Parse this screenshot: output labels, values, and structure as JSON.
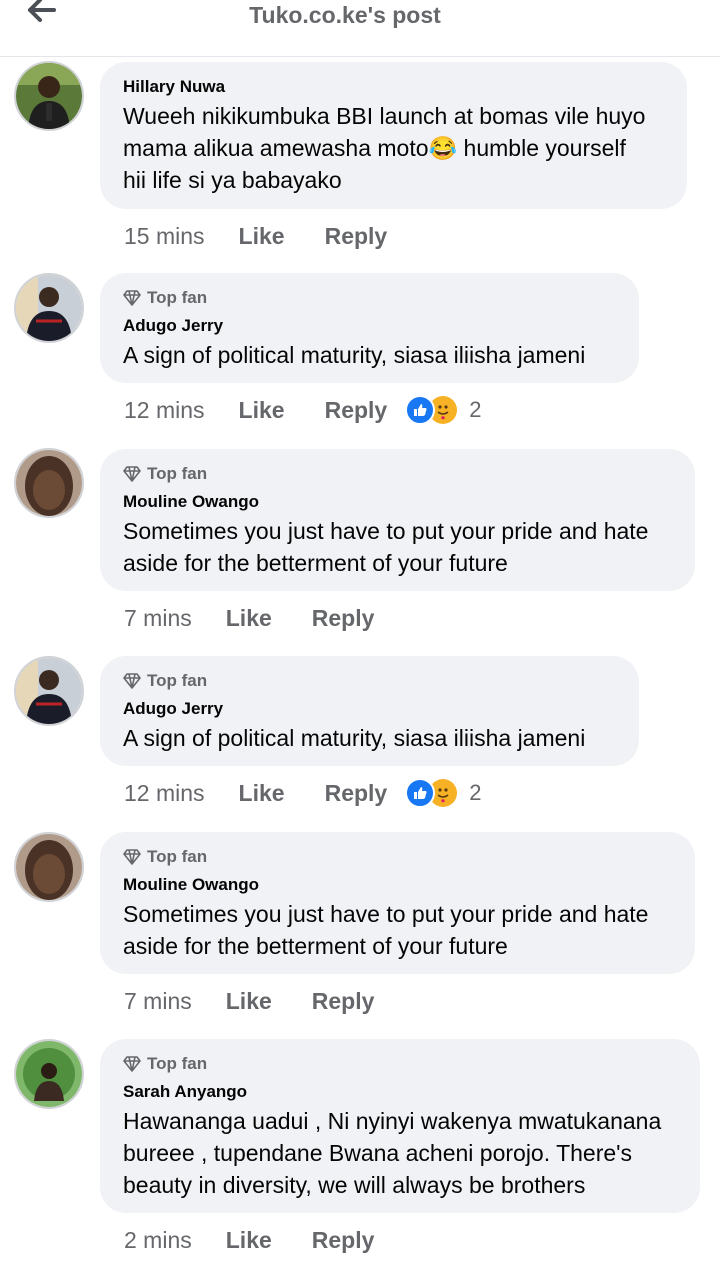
{
  "header": {
    "title": "Tuko.co.ke's post"
  },
  "colors": {
    "accent": "#1877f2",
    "bubble": "#f0f2f5",
    "meta_text": "#65676b"
  },
  "comments": [
    {
      "author": "Hillary Nuwa",
      "top_fan": false,
      "lines": [
        "Wueeh nikikumbuka BBI launch at bomas vile huyo",
        "mama alikua amewasha moto😂 humble yourself",
        "hii life si ya babayako"
      ],
      "time": "15 mins",
      "like": "Like",
      "reply": "Reply",
      "reactions": null
    },
    {
      "author": "Adugo Jerry",
      "top_fan": true,
      "badge": "Top fan",
      "lines": [
        "A sign of political maturity, siasa iliisha jameni"
      ],
      "time": "12 mins",
      "like": "Like",
      "reply": "Reply",
      "reactions": "2",
      "reaction_icons": [
        "like-icon",
        "care-icon"
      ]
    },
    {
      "author": "Mouline Owango",
      "top_fan": true,
      "badge": "Top fan",
      "lines": [
        "Sometimes you just have to put your pride and hate",
        "aside for the betterment of your future"
      ],
      "time": "7 mins",
      "like": "Like",
      "reply": "Reply",
      "reactions": null
    },
    {
      "author": "Adugo Jerry",
      "top_fan": true,
      "badge": "Top fan",
      "lines": [
        "A sign of political maturity, siasa iliisha jameni"
      ],
      "time": "12 mins",
      "like": "Like",
      "reply": "Reply",
      "reactions": "2",
      "reaction_icons": [
        "like-icon",
        "care-icon"
      ]
    },
    {
      "author": "Mouline Owango",
      "top_fan": true,
      "badge": "Top fan",
      "lines": [
        "Sometimes you just have to put your pride and hate",
        "aside for the betterment of your future"
      ],
      "time": "7 mins",
      "like": "Like",
      "reply": "Reply",
      "reactions": null
    },
    {
      "author": "Sarah Anyango",
      "top_fan": true,
      "badge": "Top fan",
      "lines": [
        "Hawananga uadui , Ni nyinyi wakenya mwatukanana",
        "bureee , tupendane Bwana acheni porojo. There's",
        "beauty in diversity, we will always be brothers"
      ],
      "time": "2 mins",
      "like": "Like",
      "reply": "Reply",
      "reactions": null
    }
  ]
}
